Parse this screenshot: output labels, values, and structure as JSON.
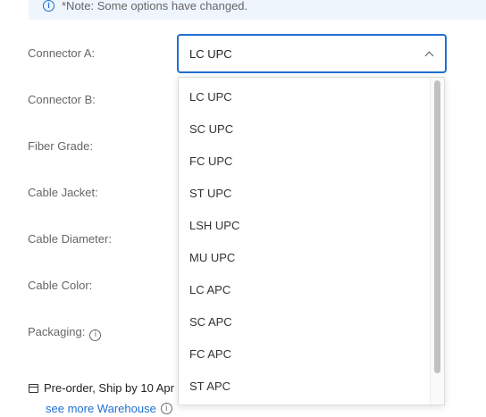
{
  "notice": {
    "text": "*Note: Some options have changed.",
    "icon": "info-icon"
  },
  "fields": {
    "connector_a": "Connector A:",
    "connector_b": "Connector B:",
    "fiber_grade": "Fiber Grade:",
    "cable_jacket": "Cable Jacket:",
    "cable_diameter": "Cable Diameter:",
    "cable_color": "Cable Color:",
    "packaging": "Packaging:"
  },
  "select": {
    "selected_value": "LC UPC",
    "options": [
      "LC UPC",
      "SC UPC",
      "FC UPC",
      "ST UPC",
      "LSH UPC",
      "MU UPC",
      "LC APC",
      "SC APC",
      "FC APC",
      "ST APC"
    ]
  },
  "shipping": {
    "preorder_text": "Pre-order, Ship by 10 Apr",
    "warehouse_link": "see more Warehouse"
  },
  "colors": {
    "accent": "#1f6fd1",
    "notice_bg": "#eef5fd"
  }
}
